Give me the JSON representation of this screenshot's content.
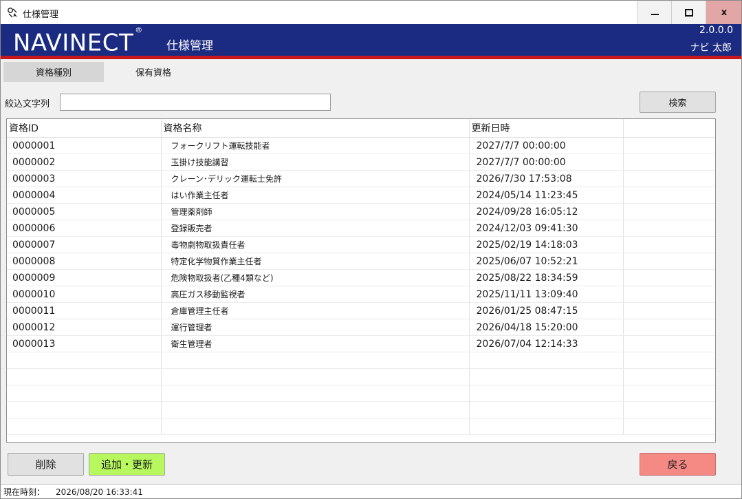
{
  "window": {
    "title": "仕様管理"
  },
  "header": {
    "logo": "NAVINECT",
    "logo_mark": "®",
    "app_title": "仕様管理",
    "version": "2.0.0.0",
    "user": "ナビ 太郎"
  },
  "tabs": [
    {
      "label": "資格種別"
    },
    {
      "label": "保有資格"
    }
  ],
  "filter": {
    "label": "絞込文字列",
    "value": "",
    "search_label": "検索"
  },
  "table": {
    "columns": [
      "資格ID",
      "資格名称",
      "更新日時"
    ],
    "rows": [
      [
        "0000001",
        "フォークリフト運転技能者",
        "2027/7/7 00:00:00"
      ],
      [
        "0000002",
        "玉掛け技能講習",
        "2027/7/7 00:00:00"
      ],
      [
        "0000003",
        "クレーン･デリック運転士免許",
        "2026/7/30 17:53:08"
      ],
      [
        "0000004",
        "はい作業主任者",
        "2024/05/14 11:23:45"
      ],
      [
        "0000005",
        "管理薬剤師",
        "2024/09/28 16:05:12"
      ],
      [
        "0000006",
        "登録販売者",
        "2024/12/03 09:41:30"
      ],
      [
        "0000007",
        "毒物劇物取扱責任者",
        "2025/02/19 14:18:03"
      ],
      [
        "0000008",
        "特定化学物質作業主任者",
        "2025/06/07 10:52:21"
      ],
      [
        "0000009",
        "危険物取扱者(乙種4類など)",
        "2025/08/22 18:34:59"
      ],
      [
        "0000010",
        "高圧ガス移動監視者",
        "2025/11/11 13:09:40"
      ],
      [
        "0000011",
        "倉庫管理主任者",
        "2026/01/25 08:47:15"
      ],
      [
        "0000012",
        "運行管理者",
        "2026/04/18 15:20:00"
      ],
      [
        "0000013",
        "衛生管理者",
        "2026/07/04 12:14:33"
      ]
    ]
  },
  "buttons": {
    "delete": "削除",
    "add_update": "追加・更新",
    "back": "戻る"
  },
  "status": {
    "label": "現在時刻：",
    "value": "2026/08/20 16:33:41"
  }
}
